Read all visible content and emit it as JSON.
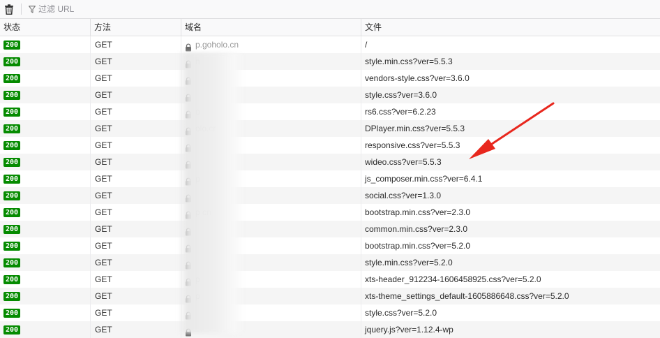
{
  "toolbar": {
    "trash_icon": "trash-icon",
    "filter_icon": "filter-icon",
    "filter_placeholder": "过滤 URL"
  },
  "columns": [
    "状态",
    "方法",
    "域名",
    "文件"
  ],
  "colors": {
    "status_ok": "#058b00",
    "arrow": "#e8271d"
  },
  "rows": [
    {
      "status": "200",
      "method": "GET",
      "domain": "p.goholo.cn",
      "file": "/"
    },
    {
      "status": "200",
      "method": "GET",
      "domain": "n",
      "file": "style.min.css?ver=5.5.3"
    },
    {
      "status": "200",
      "method": "GET",
      "domain": "",
      "file": "vendors-style.css?ver=3.6.0"
    },
    {
      "status": "200",
      "method": "GET",
      "domain": "",
      "file": "style.css?ver=3.6.0"
    },
    {
      "status": "200",
      "method": "GET",
      "domain": "o",
      "file": "rs6.css?ver=6.2.23"
    },
    {
      "status": "200",
      "method": "GET",
      "domain": "olo.cr",
      "file": "DPlayer.min.css?ver=5.5.3"
    },
    {
      "status": "200",
      "method": "GET",
      "domain": "",
      "file": "responsive.css?ver=5.5.3"
    },
    {
      "status": "200",
      "method": "GET",
      "domain": "",
      "file": "wideo.css?ver=5.5.3"
    },
    {
      "status": "200",
      "method": "GET",
      "domain": "p",
      "file": "js_composer.min.css?ver=6.4.1"
    },
    {
      "status": "200",
      "method": "GET",
      "domain": "",
      "file": "social.css?ver=1.3.0"
    },
    {
      "status": "200",
      "method": "GET",
      "domain": "p      cn",
      "file": "bootstrap.min.css?ver=2.3.0"
    },
    {
      "status": "200",
      "method": "GET",
      "domain": "",
      "file": "common.min.css?ver=2.3.0"
    },
    {
      "status": "200",
      "method": "GET",
      "domain": "",
      "file": "bootstrap.min.css?ver=5.2.0"
    },
    {
      "status": "200",
      "method": "GET",
      "domain": "",
      "file": "style.min.css?ver=5.2.0"
    },
    {
      "status": "200",
      "method": "GET",
      "domain": "p",
      "file": "xts-header_912234-1606458925.css?ver=5.2.0"
    },
    {
      "status": "200",
      "method": "GET",
      "domain": "p",
      "file": "xts-theme_settings_default-1605886648.css?ver=5.2.0"
    },
    {
      "status": "200",
      "method": "GET",
      "domain": "",
      "file": "style.css?ver=5.2.0"
    },
    {
      "status": "200",
      "method": "GET",
      "domain": "",
      "file": "jquery.js?ver=1.12.4-wp"
    }
  ]
}
